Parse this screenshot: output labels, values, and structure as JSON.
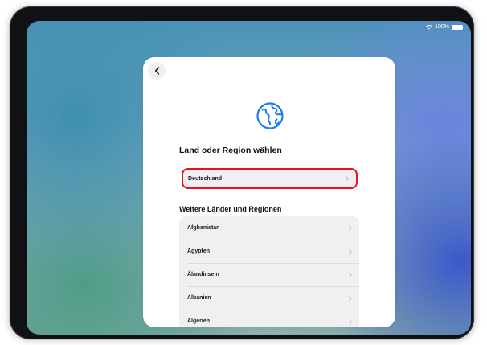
{
  "status_bar": {
    "battery": "100%",
    "icons": [
      "wifi-icon",
      "battery-icon"
    ]
  },
  "sheet": {
    "back_icon": "chevron-left-icon",
    "hero_icon": "globe-icon",
    "title": "Land oder Region wählen",
    "selected": {
      "label": "Deutschland",
      "highlight_color": "#e8121c"
    },
    "section_title": "Weitere Länder und Regionen",
    "countries": [
      {
        "label": "Afghanistan"
      },
      {
        "label": "Ägypten"
      },
      {
        "label": "Ålandinseln"
      },
      {
        "label": "Albanien"
      },
      {
        "label": "Algerien"
      }
    ]
  },
  "colors": {
    "accent_blue": "#1c7ef0",
    "selection_outline": "#e8121c"
  }
}
